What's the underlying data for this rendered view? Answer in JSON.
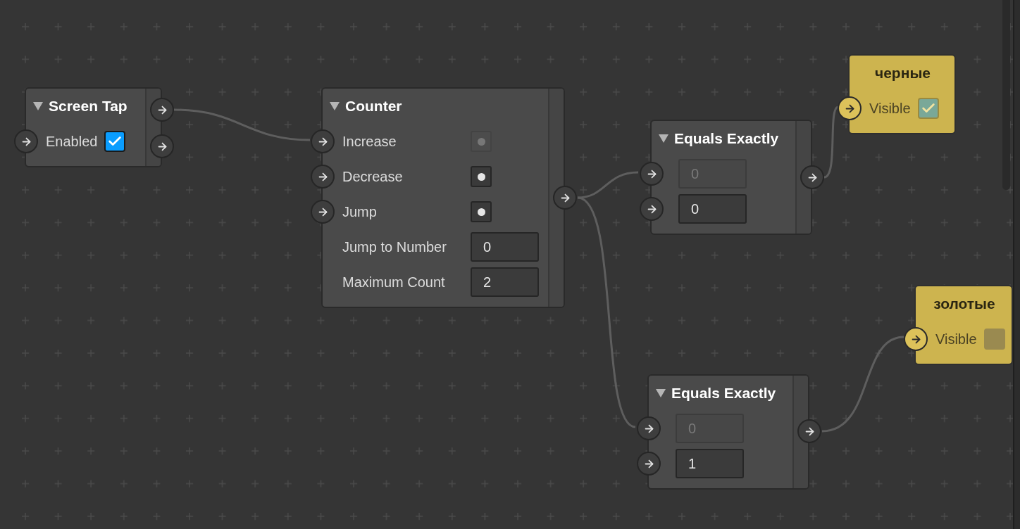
{
  "nodes": [
    {
      "kind": "patch",
      "title": "Screen Tap",
      "expanded": true,
      "rows": [
        {
          "kind": "checkbox",
          "label": "Enabled",
          "checked": true,
          "input_port": true
        }
      ]
    },
    {
      "kind": "patch",
      "title": "Counter",
      "expanded": true,
      "rows": [
        {
          "kind": "pulse",
          "label": "Increase",
          "disabled": true,
          "input_port": true
        },
        {
          "kind": "pulse",
          "label": "Decrease",
          "disabled": false,
          "input_port": true
        },
        {
          "kind": "pulse",
          "label": "Jump",
          "disabled": false,
          "input_port": true
        },
        {
          "kind": "number",
          "label": "Jump to Number",
          "value": "0",
          "disabled": false,
          "input_port": false
        },
        {
          "kind": "number",
          "label": "Maximum Count",
          "value": "2",
          "disabled": false,
          "input_port": false
        }
      ]
    },
    {
      "kind": "patch",
      "title": "Equals Exactly",
      "expanded": true,
      "rows": [
        {
          "kind": "number",
          "value": "0",
          "disabled": true,
          "input_port": true
        },
        {
          "kind": "number",
          "value": "0",
          "disabled": false,
          "input_port": true
        }
      ]
    },
    {
      "kind": "patch",
      "title": "Equals Exactly",
      "expanded": true,
      "rows": [
        {
          "kind": "number",
          "value": "0",
          "disabled": true,
          "input_port": true
        },
        {
          "kind": "number",
          "value": "1",
          "disabled": false,
          "input_port": true
        }
      ]
    },
    {
      "kind": "object",
      "title": "черные",
      "rows": [
        {
          "kind": "checkbox",
          "label": "Visible",
          "checked": true,
          "input_port": true
        }
      ]
    },
    {
      "kind": "object",
      "title": "золотые",
      "rows": [
        {
          "kind": "checkbox",
          "label": "Visible",
          "checked": false,
          "input_port": true
        }
      ]
    }
  ]
}
